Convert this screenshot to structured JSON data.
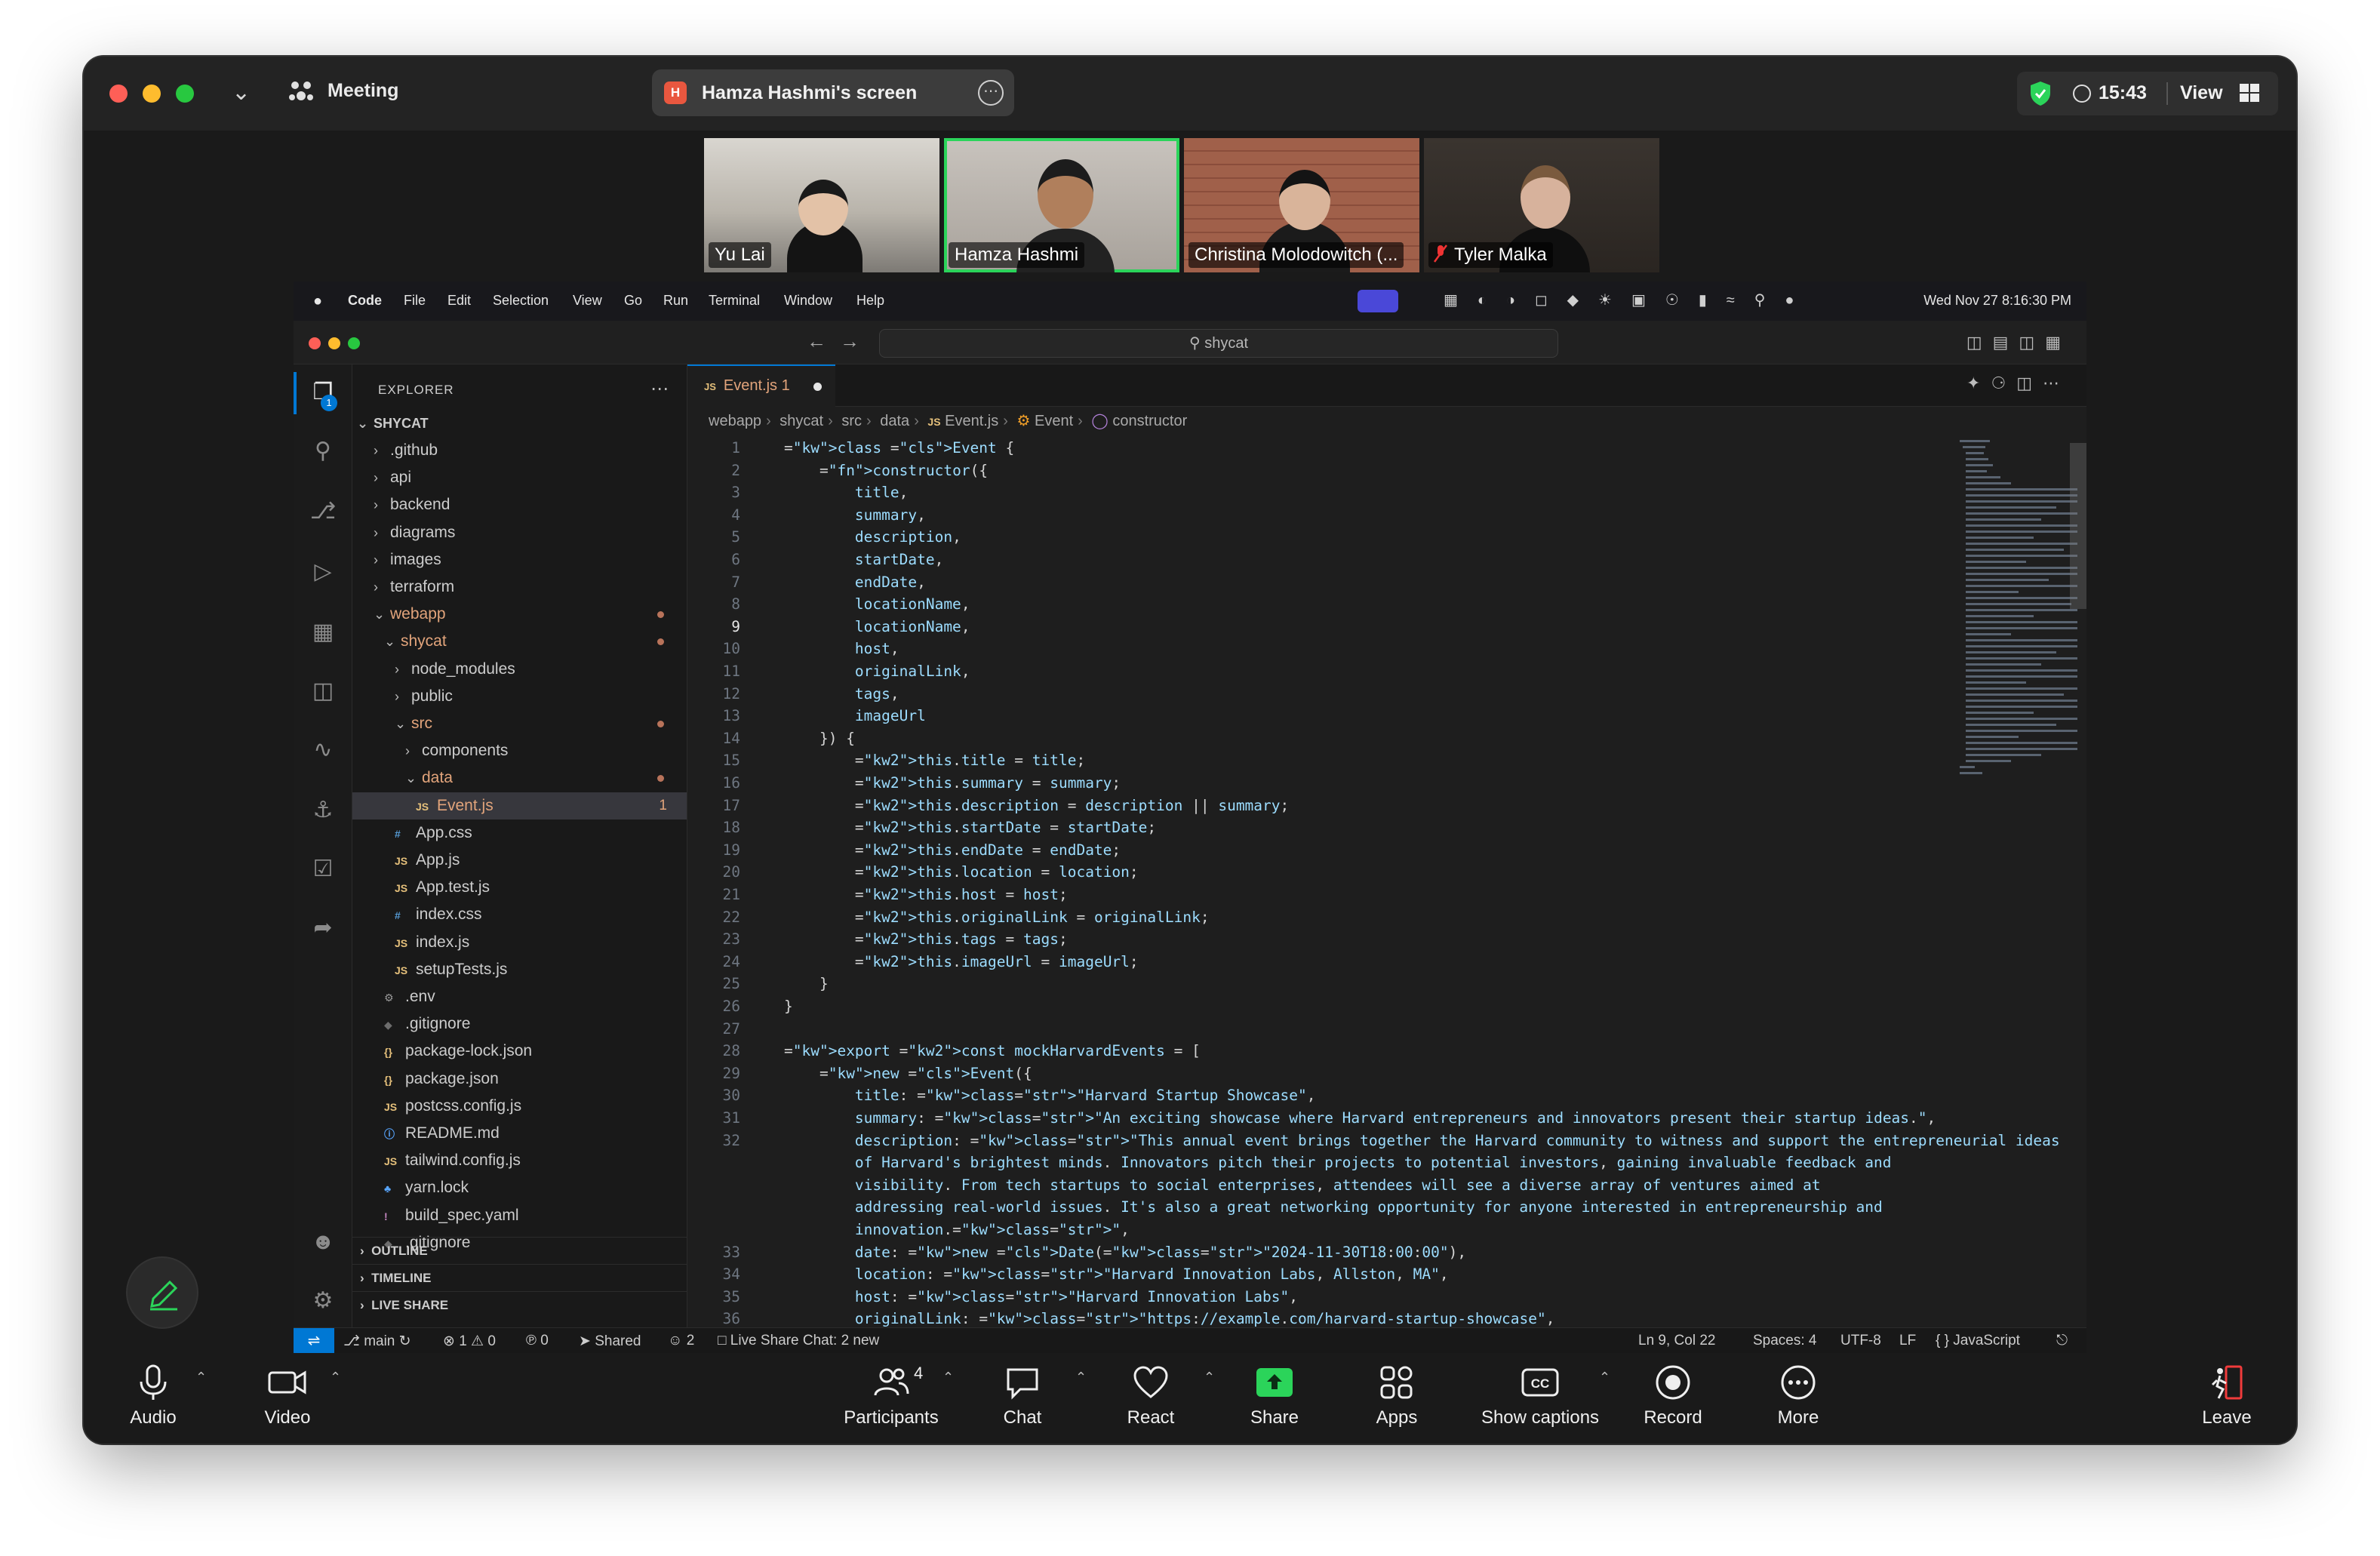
{
  "zoom": {
    "meeting_label": "Meeting",
    "share_initial": "H",
    "share_label": "Hamza Hashmi's screen",
    "time": "15:43",
    "view_label": "View",
    "accent_green": "#2bd45a"
  },
  "participants": [
    {
      "name": "Yu Lai"
    },
    {
      "name": "Hamza Hashmi"
    },
    {
      "name": "Christina Molodowitch (..."
    },
    {
      "name": "Tyler Malka"
    }
  ],
  "mac_menu": {
    "app": "Code",
    "items": [
      "File",
      "Edit",
      "Selection",
      "View",
      "Go",
      "Run",
      "Terminal",
      "Window",
      "Help"
    ],
    "datetime": "Wed Nov 27  8:16:30 PM"
  },
  "vscode": {
    "search_label": "shycat",
    "explorer_title": "EXPLORER",
    "explorer_badge": "1",
    "root": "SHYCAT",
    "tree": [
      {
        "label": ".github",
        "type": "folder"
      },
      {
        "label": "api",
        "type": "folder"
      },
      {
        "label": "backend",
        "type": "folder"
      },
      {
        "label": "diagrams",
        "type": "folder"
      },
      {
        "label": "images",
        "type": "folder"
      },
      {
        "label": "terraform",
        "type": "folder"
      },
      {
        "label": "webapp",
        "type": "folder-open"
      },
      {
        "label": "shycat",
        "type": "folder-open"
      },
      {
        "label": "node_modules",
        "type": "folder"
      },
      {
        "label": "public",
        "type": "folder"
      },
      {
        "label": "src",
        "type": "folder-open"
      },
      {
        "label": "components",
        "type": "folder"
      },
      {
        "label": "data",
        "type": "folder-open"
      },
      {
        "label": "Event.js",
        "type": "js",
        "badge": "1"
      },
      {
        "label": "App.css",
        "type": "css"
      },
      {
        "label": "App.js",
        "type": "js"
      },
      {
        "label": "App.test.js",
        "type": "js"
      },
      {
        "label": "index.css",
        "type": "css"
      },
      {
        "label": "index.js",
        "type": "js"
      },
      {
        "label": "setupTests.js",
        "type": "js"
      },
      {
        "label": ".env",
        "type": "gear"
      },
      {
        "label": ".gitignore",
        "type": "git"
      },
      {
        "label": "package-lock.json",
        "type": "json"
      },
      {
        "label": "package.json",
        "type": "json"
      },
      {
        "label": "postcss.config.js",
        "type": "js"
      },
      {
        "label": "README.md",
        "type": "info"
      },
      {
        "label": "tailwind.config.js",
        "type": "js"
      },
      {
        "label": "yarn.lock",
        "type": "yarn"
      },
      {
        "label": "build_spec.yaml",
        "type": "yaml"
      },
      {
        "label": ".gitignore",
        "type": "git"
      }
    ],
    "sections": [
      "OUTLINE",
      "TIMELINE",
      "LIVE SHARE"
    ],
    "tab_label": "Event.js",
    "tab_problems": "1",
    "breadcrumb": [
      "webapp",
      "shycat",
      "src",
      "data",
      "Event.js",
      "Event",
      "constructor"
    ],
    "code_lines": [
      {
        "n": "1",
        "t": "class Event {"
      },
      {
        "n": "2",
        "t": "    constructor({"
      },
      {
        "n": "3",
        "t": "        title,"
      },
      {
        "n": "4",
        "t": "        summary,"
      },
      {
        "n": "5",
        "t": "        description,"
      },
      {
        "n": "6",
        "t": "        startDate,"
      },
      {
        "n": "7",
        "t": "        endDate,"
      },
      {
        "n": "8",
        "t": "        locationName,"
      },
      {
        "n": "9",
        "t": "        locationName,"
      },
      {
        "n": "10",
        "t": "        host,"
      },
      {
        "n": "11",
        "t": "        originalLink,"
      },
      {
        "n": "12",
        "t": "        tags,"
      },
      {
        "n": "13",
        "t": "        imageUrl"
      },
      {
        "n": "14",
        "t": "    }) {"
      },
      {
        "n": "15",
        "t": "        this.title = title;"
      },
      {
        "n": "16",
        "t": "        this.summary = summary;"
      },
      {
        "n": "17",
        "t": "        this.description = description || summary;"
      },
      {
        "n": "18",
        "t": "        this.startDate = startDate;"
      },
      {
        "n": "19",
        "t": "        this.endDate = endDate;"
      },
      {
        "n": "20",
        "t": "        this.location = location;"
      },
      {
        "n": "21",
        "t": "        this.host = host;"
      },
      {
        "n": "22",
        "t": "        this.originalLink = originalLink;"
      },
      {
        "n": "23",
        "t": "        this.tags = tags;"
      },
      {
        "n": "24",
        "t": "        this.imageUrl = imageUrl;"
      },
      {
        "n": "25",
        "t": "    }"
      },
      {
        "n": "26",
        "t": "}"
      },
      {
        "n": "27",
        "t": ""
      },
      {
        "n": "28",
        "t": "export const mockHarvardEvents = ["
      },
      {
        "n": "29",
        "t": "    new Event({"
      },
      {
        "n": "30",
        "t": "        title: \"Harvard Startup Showcase\","
      },
      {
        "n": "31",
        "t": "        summary: \"An exciting showcase where Harvard entrepreneurs and innovators present their startup ideas.\","
      },
      {
        "n": "32",
        "t": "        description: \"This annual event brings together the Harvard community to witness and support the entrepreneurial ideas"
      },
      {
        "n": "",
        "t": "        of Harvard's brightest minds. Innovators pitch their projects to potential investors, gaining invaluable feedback and"
      },
      {
        "n": "",
        "t": "        visibility. From tech startups to social enterprises, attendees will see a diverse array of ventures aimed at"
      },
      {
        "n": "",
        "t": "        addressing real-world issues. It's also a great networking opportunity for anyone interested in entrepreneurship and"
      },
      {
        "n": "",
        "t": "        innovation.\","
      },
      {
        "n": "33",
        "t": "        date: new Date(\"2024-11-30T18:00:00\"),"
      },
      {
        "n": "34",
        "t": "        location: \"Harvard Innovation Labs, Allston, MA\","
      },
      {
        "n": "35",
        "t": "        host: \"Harvard Innovation Labs\","
      },
      {
        "n": "36",
        "t": "        originalLink: \"https://example.com/harvard-startup-showcase\","
      }
    ],
    "status": {
      "branch": "main",
      "problems": "1",
      "warnings": "0",
      "ports": "0",
      "shared": "Shared",
      "participants": "2",
      "chat": "Live Share Chat: 2 new",
      "cursor": "Ln 9, Col 22",
      "spaces": "Spaces: 4",
      "encoding": "UTF-8",
      "eol": "LF",
      "language": "JavaScript"
    }
  },
  "toolbar": {
    "audio": "Audio",
    "video": "Video",
    "participants": "Participants",
    "participant_count": "4",
    "chat": "Chat",
    "react": "React",
    "share": "Share",
    "apps": "Apps",
    "captions": "Show captions",
    "record": "Record",
    "more": "More",
    "leave": "Leave"
  }
}
